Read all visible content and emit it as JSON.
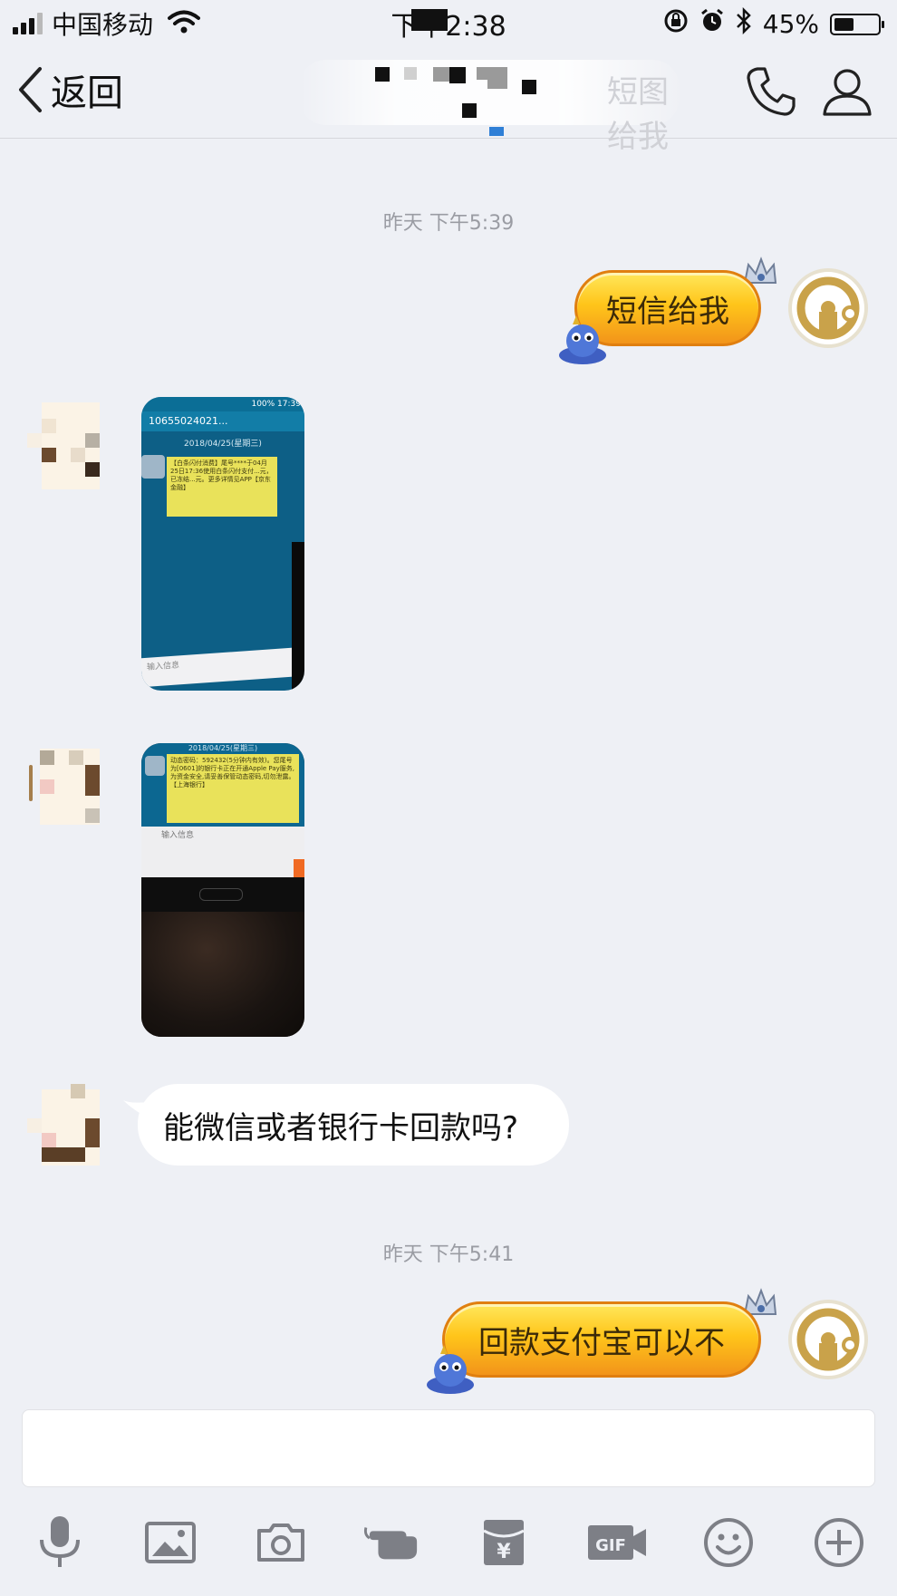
{
  "status_bar": {
    "carrier": "中国移动",
    "time": "下午2:38",
    "battery_percent_label": "45%",
    "battery_level": 0.45
  },
  "nav": {
    "back_label": "返回",
    "faded_title": "短图给我"
  },
  "messages": {
    "timestamp_1": "昨天 下午5:39",
    "msg_1": "短信给我",
    "msg_4": "能微信或者银行卡回款吗?",
    "timestamp_2": "昨天 下午5:41",
    "msg_5": "回款支付宝可以不"
  },
  "photo_1": {
    "phone_number": "10655024021...",
    "date_header": "2018/04/25(星期三)",
    "sms_text": "【白条闪付消费】尾号****于04月25日17:36使用白条闪付支付...元，已冻结...元。更多详情见APP【京东金融】",
    "sms_time": "17:36",
    "input_hint": "输入信息",
    "status_right": "100% 17:39"
  },
  "photo_2": {
    "date_header": "2018/04/25(星期三)",
    "sms_text": "动态密码：592432(5分钟内有效)。您尾号为[0601]的银行卡正在开通Apple Pay服务,为资金安全,请妥善保管动态密码,切勿泄露。【上海银行】",
    "sms_time": "17:37",
    "input_hint": "输入信息"
  },
  "toolbar": {
    "items": [
      "microphone",
      "image",
      "camera",
      "poke",
      "red-packet",
      "gif",
      "emoji",
      "plus"
    ],
    "gif_label": "GIF",
    "red_packet_symbol": "¥"
  },
  "colors": {
    "background": "#eef0f5",
    "bubble_gold": "#ffc51a",
    "icon_gray": "#7d7f86"
  }
}
